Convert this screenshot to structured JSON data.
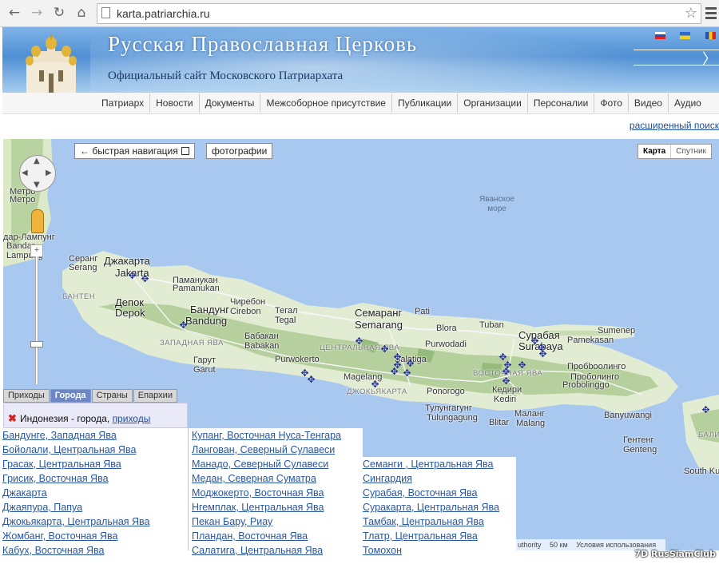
{
  "browser": {
    "url": "karta.patriarchia.ru",
    "icons": [
      "back-arrow-icon",
      "forward-arrow-icon",
      "reload-icon",
      "home-icon",
      "page-icon",
      "star-icon",
      "menu-icon"
    ]
  },
  "header": {
    "title": "Русская Православная Церковь",
    "subtitle": "Официальный сайт Московского Патриархата",
    "flags": [
      "ru",
      "ua",
      "md"
    ]
  },
  "nav": [
    "Патриарх",
    "Новости",
    "Документы",
    "Межсоборное присутствие",
    "Публикации",
    "Организации",
    "Персоналии",
    "Фото",
    "Видео",
    "Аудио"
  ],
  "advanced_search": "расширенный поиск",
  "map": {
    "quick_nav": "← быстрая навигация",
    "photos": "фотографии",
    "map_type_map": "Карта",
    "map_type_satellite": "Спутник",
    "sea_label": "Яванское\nморе",
    "labels": [
      {
        "t": "Метро"
      },
      {
        "t": "Метро"
      },
      {
        "t": "дар-Лампунг"
      },
      {
        "t": "Bandar"
      },
      {
        "t": "Lampung"
      },
      {
        "t": "Серанг"
      },
      {
        "t": "Serang"
      },
      {
        "t": "Джакарта"
      },
      {
        "t": "Jakarta"
      },
      {
        "t": "Паманукан"
      },
      {
        "t": "Pamanukan"
      },
      {
        "t": "Депок"
      },
      {
        "t": "Depok"
      },
      {
        "t": "Бандунг"
      },
      {
        "t": "Bandung"
      },
      {
        "t": "Чиребон"
      },
      {
        "t": "Cirebon"
      },
      {
        "t": "Тегал"
      },
      {
        "t": "Tegal"
      },
      {
        "t": "Семаранг"
      },
      {
        "t": "Semarang"
      },
      {
        "t": "Pati"
      },
      {
        "t": "Blora"
      },
      {
        "t": "Purwodadi"
      },
      {
        "t": "Tuban"
      },
      {
        "t": "Сурабая"
      },
      {
        "t": "Surabaya"
      },
      {
        "t": "Sumenep"
      },
      {
        "t": "Pamekasan"
      },
      {
        "t": "Бабакан"
      },
      {
        "t": "Babakan"
      },
      {
        "t": "Purwokerto"
      },
      {
        "t": "Salatiga"
      },
      {
        "t": "Magelang"
      },
      {
        "t": "Гарут"
      },
      {
        "t": "Garut"
      },
      {
        "t": "Пробbooлинго"
      },
      {
        "t": "Пробoлинго"
      },
      {
        "t": "Probolinggo"
      },
      {
        "t": "Кедири"
      },
      {
        "t": "Kediri"
      },
      {
        "t": "Ponorogo"
      },
      {
        "t": "Тулунгагунг"
      },
      {
        "t": "Tulungagung"
      },
      {
        "t": "Blitar"
      },
      {
        "t": "Маланг"
      },
      {
        "t": "Malang"
      },
      {
        "t": "Banyuwangi"
      },
      {
        "t": "Гентенг"
      },
      {
        "t": "Genteng"
      },
      {
        "t": "South Ku"
      },
      {
        "t": "БАЛИ"
      },
      {
        "t": "БАНТЕН"
      },
      {
        "t": "ЗАПАДНАЯ ЯВА"
      },
      {
        "t": "ЦЕНТРАЛЬНАЯ ЯВА"
      },
      {
        "t": "ВОСТОЧНАЯ ЯВА"
      },
      {
        "t": "ДЖОКЬЯКАРТА"
      }
    ],
    "tabs": [
      "Приходы",
      "Города",
      "Страны",
      "Епархии"
    ],
    "active_tab": "Города",
    "filter_text": "Индонезия - города,",
    "filter_link": "приходы",
    "attribution": [
      "uthority",
      "50 км",
      "Условия использования"
    ],
    "marker_count": 22
  },
  "cities": {
    "col1": [
      "Бандунге, Западная Ява",
      "Бойолали, Центральная Ява",
      "Грасак, Центральная Ява",
      "Грисик, Восточная Ява",
      "Джакарта",
      "Джаяпура, Папуа",
      "Джокьякарта, Центральная Ява",
      "Жомбанг, Восточная Ява",
      "Кабух, Восточная Ява"
    ],
    "col2": [
      "Купанг, Восточная Нуса-Тенгара",
      "Лангован, Северный Сулавеси",
      "Манадо, Северный Сулавеси",
      "Медан, Северная Суматра",
      "Моджокерто, Восточная Ява",
      "Нгемплак, Центральная Ява",
      "Пекан Бару, Риау",
      "Пландан, Восточная Ява",
      "Салатига, Центральная Ява"
    ],
    "col3": [
      "Семанги , Центральная Ява",
      "Сингардия",
      "Сурабая, Восточная Ява",
      "Суракарта, Центральная Ява",
      "Тамбак, Центральная Ява",
      "Тлатр, Центральная Ява",
      "Томохон"
    ]
  },
  "watermark": "7D RusSiamClub"
}
